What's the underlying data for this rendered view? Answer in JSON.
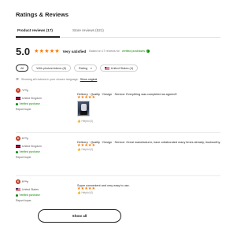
{
  "header": {
    "title": "Ratings & Reviews"
  },
  "tabs": [
    {
      "label": "Product reviews (17)",
      "active": true
    },
    {
      "label": "Store reviews (621)",
      "active": false
    }
  ],
  "summary": {
    "score": "5.0",
    "rating": 5,
    "sentiment": "Very satisfied",
    "based_on": "Based on 17 reviews for",
    "verified": "verified purchases"
  },
  "filters": {
    "all": "All",
    "with_photos": "With photos/videos (8)",
    "rating": "Rating",
    "country": "United States (4)"
  },
  "language_note": {
    "text": "Showing all reviews in your chosen language.",
    "link": "Show original"
  },
  "reviews": [
    {
      "avatar": "Y",
      "name": "Y***y",
      "country": "United Kingdom",
      "verified": "Verified purchase",
      "report": "Report buyer",
      "rating": 5,
      "text": "Delivery · Quality · Design · Service: Everything was completed as agreed!!",
      "helpful": "Helpful (0)",
      "has_photo": true
    },
    {
      "avatar": "K",
      "name": "K***y",
      "country": "United Kingdom",
      "verified": "Verified purchase",
      "report": "Report buyer",
      "rating": 5,
      "text": "Delivery · Quality · Design · Service: Great manufacturer, have collaborated many times already, trustworthy.",
      "helpful": "Helpful (0)",
      "has_photo": false
    },
    {
      "avatar": "K",
      "name": "K***y",
      "country": "United States",
      "verified": "Verified purchase",
      "report": "Report buyer",
      "rating": 5,
      "text": "Super convenient and very easy to use.",
      "helpful": "Helpful (0)",
      "has_photo": false
    }
  ],
  "show_all": "Show all",
  "colors": {
    "star": "#fb7701",
    "verified": "#0a8800",
    "avatar": "#c23f27"
  },
  "icons": {
    "star": "star-icon",
    "thumb": "thumbs-up-icon",
    "globe": "language-icon",
    "check": "check-circle-icon"
  }
}
